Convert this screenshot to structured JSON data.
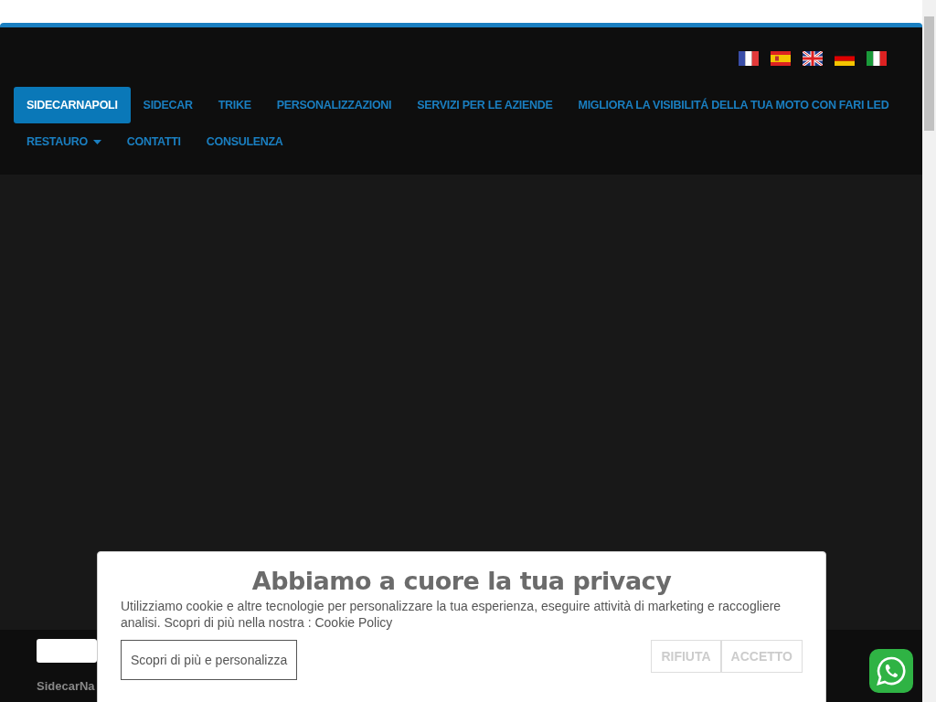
{
  "nav": {
    "items": [
      {
        "label": "SIDECARNAPOLI",
        "selected": true,
        "has_submenu": false
      },
      {
        "label": "SIDECAR",
        "selected": false,
        "has_submenu": false
      },
      {
        "label": "TRIKE",
        "selected": false,
        "has_submenu": false
      },
      {
        "label": "PERSONALIZZAZIONI",
        "selected": false,
        "has_submenu": false
      },
      {
        "label": "SERVIZI PER LE AZIENDE",
        "selected": false,
        "has_submenu": false
      },
      {
        "label": "MIGLIORA LA VISIBILITÁ DELLA TUA MOTO CON FARI LED",
        "selected": false,
        "has_submenu": false
      },
      {
        "label": "RESTAURO",
        "selected": false,
        "has_submenu": true
      },
      {
        "label": "CONTATTI",
        "selected": false,
        "has_submenu": false
      },
      {
        "label": "CONSULENZA",
        "selected": false,
        "has_submenu": false
      }
    ]
  },
  "footer": {
    "site_name": "SidecarNa"
  },
  "cookie_banner": {
    "title": "Abbiamo a cuore la tua privacy",
    "text": "Utilizziamo cookie e altre tecnologie per personalizzare la tua esperienza, eseguire attività di marketing e raccogliere analisi. Scopri di più nella nostra :",
    "link": "Cookie Policy",
    "customize_button": "Scopri di più e personalizza",
    "reject_button": "RIFIUTA",
    "accept_button": "ACCETTO"
  }
}
